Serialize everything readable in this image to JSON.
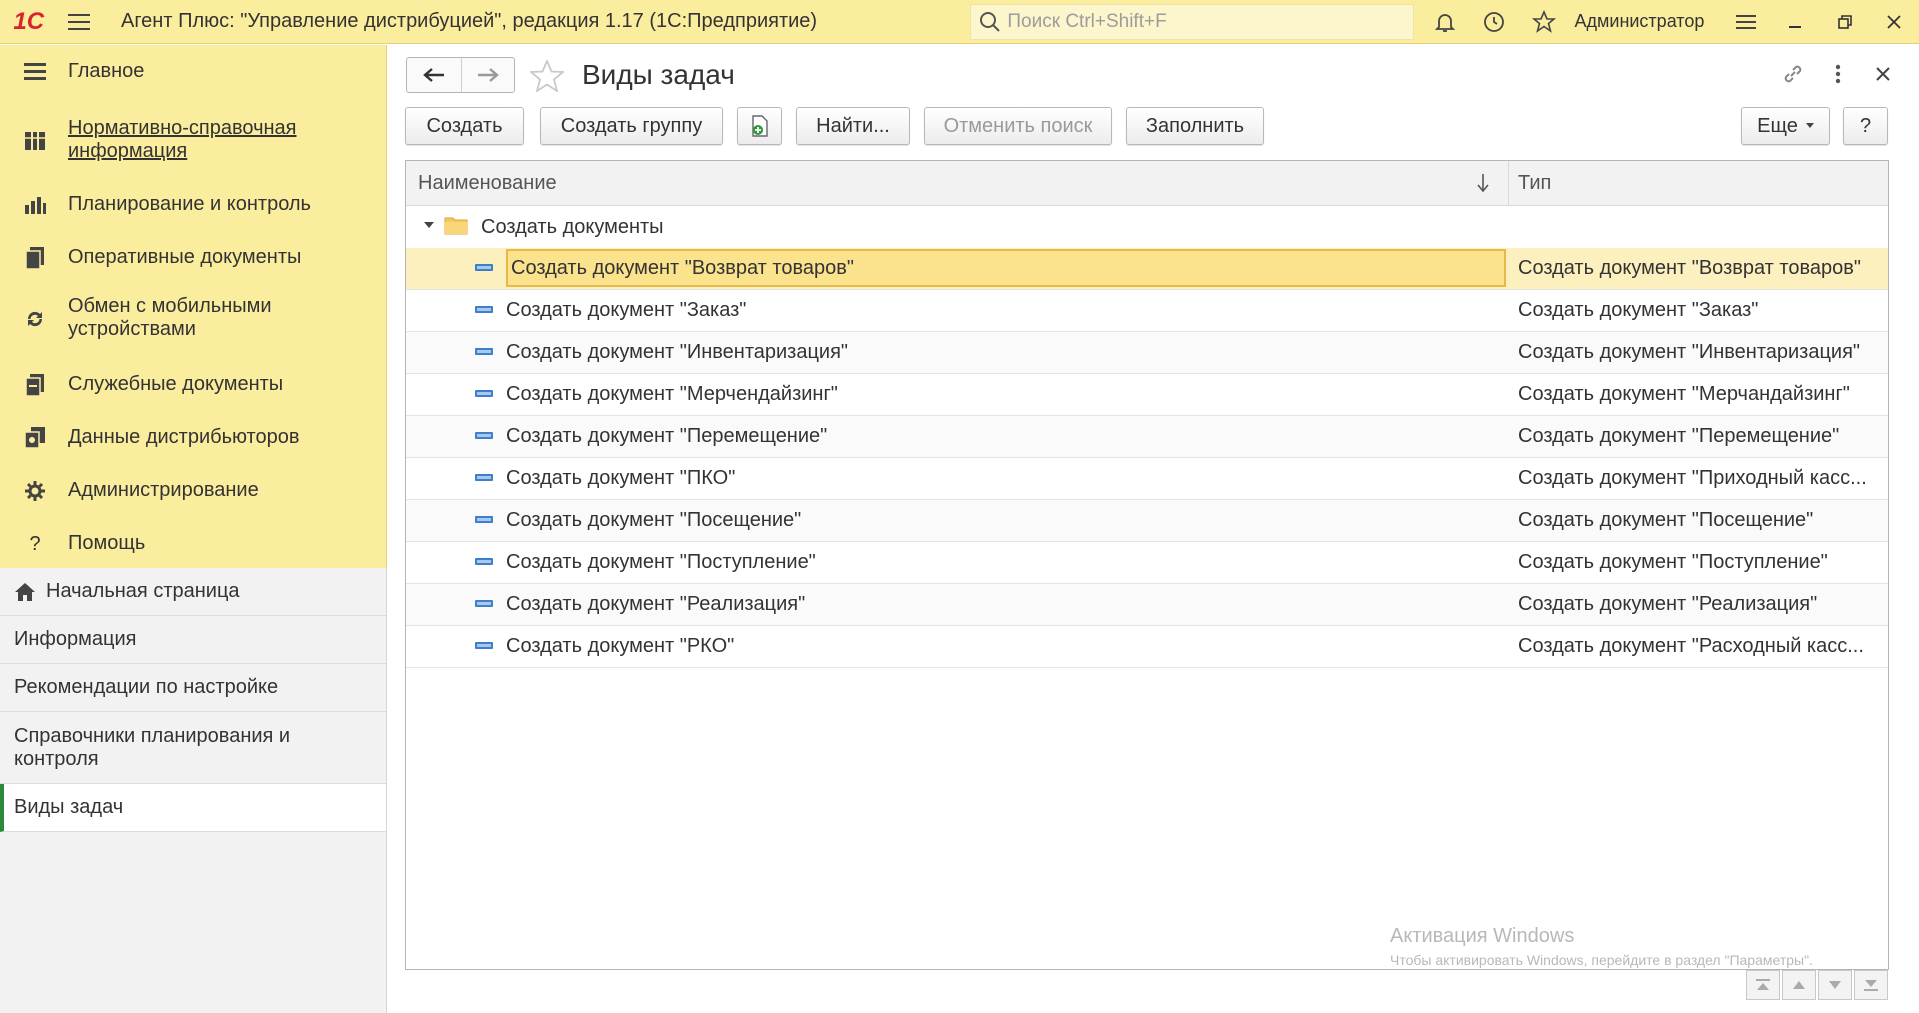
{
  "titlebar": {
    "logo": "1С",
    "app_title": "Агент Плюс: \"Управление дистрибуцией\", редакция 1.17  (1С:Предприятие)",
    "search_placeholder": "Поиск Ctrl+Shift+F",
    "user": "Администратор"
  },
  "sections": [
    {
      "label": "Главное",
      "icon": "list-icon"
    },
    {
      "label": "Нормативно-справочная информация",
      "icon": "catalog-icon"
    },
    {
      "label": "Планирование и контроль",
      "icon": "chart-icon"
    },
    {
      "label": "Оперативные документы",
      "icon": "documents-icon"
    },
    {
      "label": "Обмен с мобильными устройствами",
      "icon": "sync-icon"
    },
    {
      "label": "Служебные документы",
      "icon": "service-docs-icon"
    },
    {
      "label": "Данные дистрибьюторов",
      "icon": "distributor-icon"
    },
    {
      "label": "Администрирование",
      "icon": "gear-icon"
    },
    {
      "label": "Помощь",
      "icon": "question-icon"
    }
  ],
  "open_windows": [
    {
      "label": "Начальная страница"
    },
    {
      "label": "Информация"
    },
    {
      "label": "Рекомендации по настройке"
    },
    {
      "label": "Справочники планирования и контроля"
    },
    {
      "label": "Виды задач"
    }
  ],
  "page": {
    "title": "Виды задач"
  },
  "toolbar": {
    "create": "Создать",
    "create_group": "Создать группу",
    "find": "Найти...",
    "cancel_search": "Отменить поиск",
    "fill": "Заполнить",
    "more": "Еще",
    "help": "?"
  },
  "table": {
    "columns": [
      "Наименование",
      "Тип"
    ],
    "group": "Создать документы",
    "rows": [
      {
        "name": "Создать документ \"Возврат товаров\"",
        "type": "Создать документ \"Возврат товаров\""
      },
      {
        "name": "Создать документ \"Заказ\"",
        "type": "Создать документ \"Заказ\""
      },
      {
        "name": "Создать документ \"Инвентаризация\"",
        "type": "Создать документ \"Инвентаризация\""
      },
      {
        "name": "Создать документ \"Мерчендайзинг\"",
        "type": "Создать документ \"Мерчандайзинг\""
      },
      {
        "name": "Создать документ \"Перемещение\"",
        "type": "Создать документ \"Перемещение\""
      },
      {
        "name": "Создать документ \"ПКО\"",
        "type": "Создать документ \"Приходный касс..."
      },
      {
        "name": "Создать документ \"Посещение\"",
        "type": "Создать документ \"Посещение\""
      },
      {
        "name": "Создать документ \"Поступление\"",
        "type": "Создать документ \"Поступление\""
      },
      {
        "name": "Создать документ \"Реализация\"",
        "type": "Создать документ \"Реализация\""
      },
      {
        "name": "Создать документ \"РКО\"",
        "type": "Создать документ \"Расходный касс..."
      }
    ]
  },
  "watermark": {
    "line1": "Активация Windows",
    "line2": "Чтобы активировать Windows, перейдите в раздел \"Параметры\"."
  },
  "colors": {
    "sidebar_bg": "#FBED9E",
    "selected_row": "#FBE38D",
    "active_window_marker": "#2C8A3C"
  }
}
